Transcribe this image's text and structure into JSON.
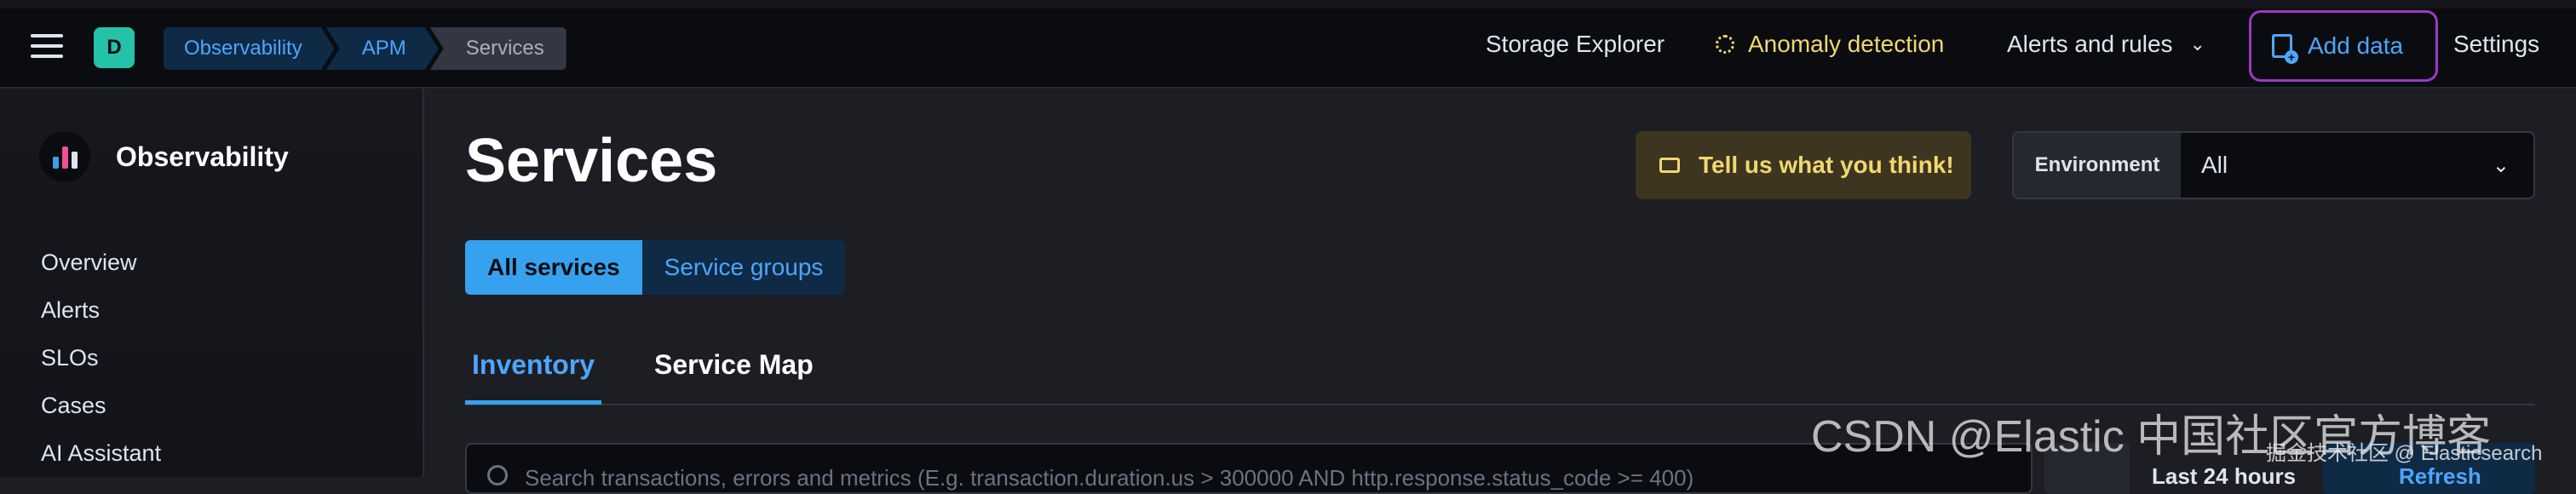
{
  "header": {
    "space_initial": "D",
    "breadcrumbs": [
      "Observability",
      "APM",
      "Services"
    ],
    "nav": {
      "storage_explorer": "Storage Explorer",
      "anomaly_detection": "Anomaly detection",
      "alerts_and_rules": "Alerts and rules",
      "add_data": "Add data",
      "settings": "Settings"
    }
  },
  "sidebar": {
    "title": "Observability",
    "items": [
      "Overview",
      "Alerts",
      "SLOs",
      "Cases",
      "AI Assistant"
    ]
  },
  "main": {
    "title": "Services",
    "feedback_label": "Tell us what you think!",
    "environment": {
      "label": "Environment",
      "value": "All"
    },
    "button_group": [
      "All services",
      "Service groups"
    ],
    "tabs": [
      "Inventory",
      "Service Map"
    ],
    "search_placeholder": "Search transactions, errors and metrics (E.g. transaction.duration.us > 300000 AND http.response.status_code >= 400)",
    "date_range": "Last 24 hours",
    "refresh_label": "Refresh"
  },
  "watermark": {
    "csdn": "CSDN @Elastic 中国社区官方博客",
    "juejin": "掘金技术社区 @ Elasticsearch"
  },
  "colors": {
    "accent": "#36a2ef",
    "link": "#4da6ff",
    "warning": "#f1d86f",
    "add_data_border": "#9b38c7",
    "space_avatar": "#24c2a8"
  },
  "icons": [
    "menu-icon",
    "anomaly-icon",
    "chevron-down-icon",
    "add-data-icon",
    "feedback-icon",
    "search-icon",
    "calendar-icon"
  ]
}
